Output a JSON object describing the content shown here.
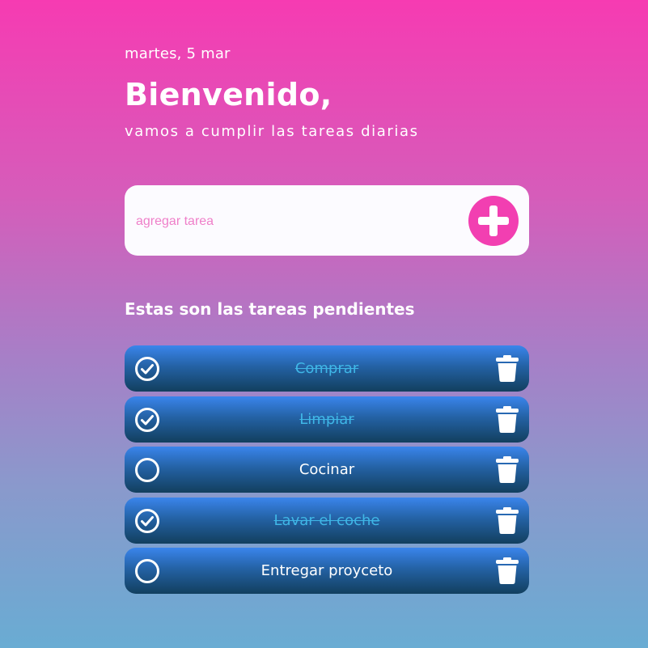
{
  "header": {
    "date": "martes, 5 mar",
    "title": "Bienvenido,",
    "subtitle": "vamos a cumplir las tareas diarias"
  },
  "add_task": {
    "placeholder": "agregar tarea",
    "value": "",
    "button_icon": "plus-icon"
  },
  "section_title": "Estas son las tareas pendientes",
  "tasks": [
    {
      "label": "Comprar",
      "done": true
    },
    {
      "label": "Limpiar",
      "done": true
    },
    {
      "label": "Cocinar",
      "done": false
    },
    {
      "label": "Lavar el coche",
      "done": true
    },
    {
      "label": "Entregar proyceto",
      "done": false
    }
  ],
  "icons": {
    "check": "check-circle-icon",
    "unchecked": "empty-circle-icon",
    "delete": "trash-icon"
  },
  "colors": {
    "gradient_top": "#f63bb2",
    "gradient_bottom": "#69acd3",
    "accent": "#f23fb1",
    "task_bg_top": "#3a85ec",
    "task_bg_bottom": "#123f5e",
    "done_text": "#3fb6e6"
  }
}
